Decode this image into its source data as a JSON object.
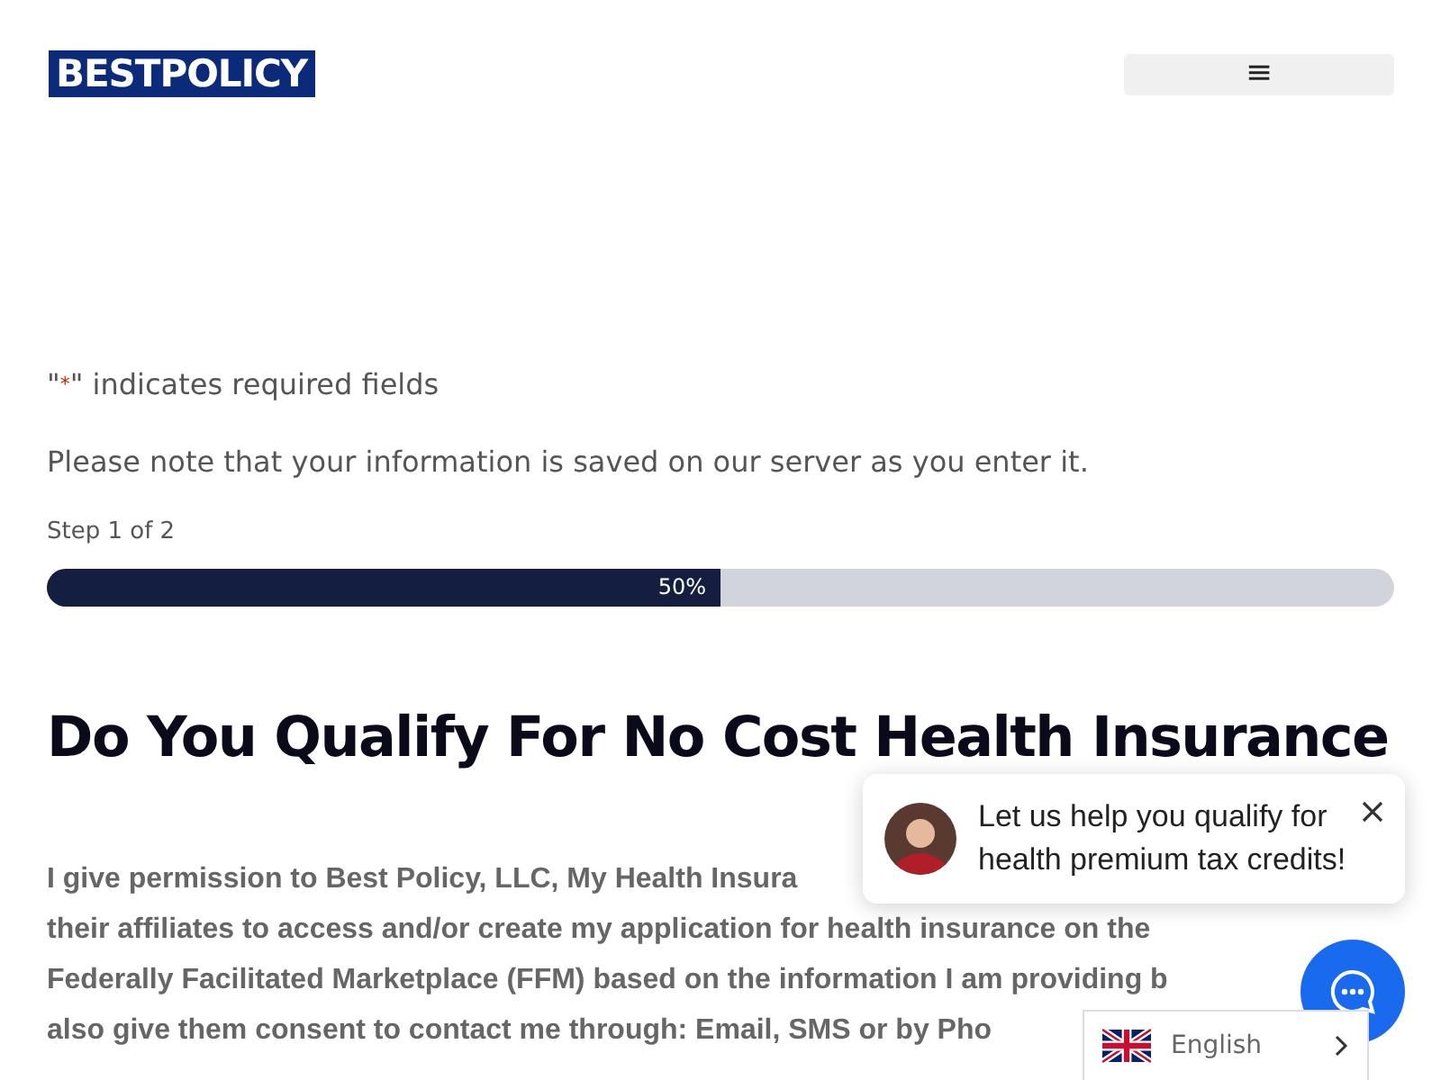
{
  "header": {
    "logo": "BESTPOLICY",
    "menu_icon": "≡"
  },
  "required_note": {
    "prefix": "\"",
    "mark": "*",
    "suffix": "\" indicates required fields"
  },
  "save_note": "Please note that your information is saved on our server as you enter it.",
  "step": "Step 1 of 2",
  "progress": {
    "level": 0.5,
    "reading": "50%"
  },
  "heading": "Do You Qualify For No Cost Health Insurance",
  "consent_lines": [
    "I give permission to Best Policy, LLC, My Health Insura",
    "their affiliates to access and/or create my application for health insurance on the",
    "Federally Facilitated Marketplace (FFM) based on the information I am providing b",
    "also give them consent to contact me through: Email, SMS or by Pho"
  ],
  "chat_popup": {
    "message": "Let us help you qualify for health premium tax credits!"
  },
  "language": {
    "label": "English"
  }
}
